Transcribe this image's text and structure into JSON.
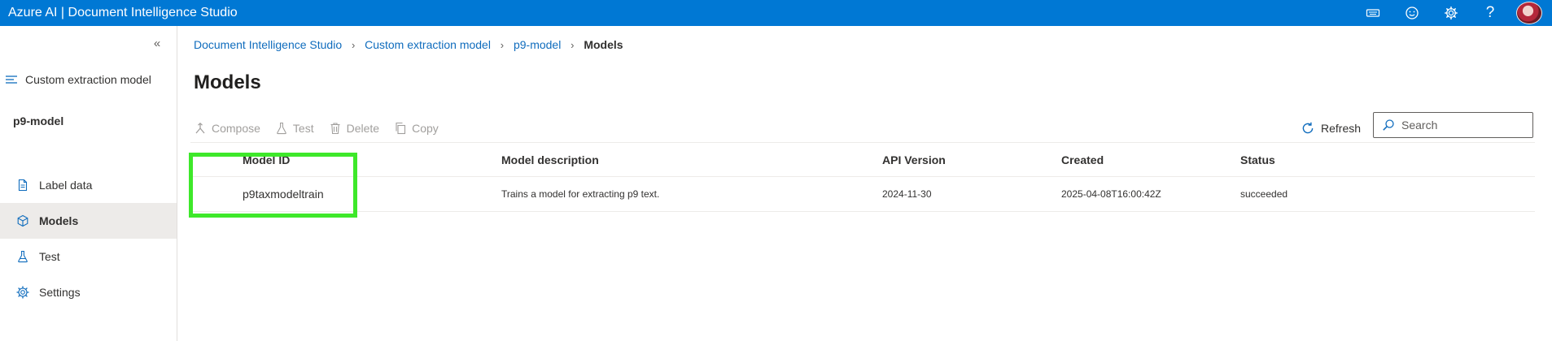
{
  "app": {
    "title": "Azure AI | Document Intelligence Studio"
  },
  "topbar": {
    "icons": [
      "keyboard-icon",
      "feedback-smiley-icon",
      "settings-gear-icon",
      "help-icon"
    ],
    "help_glyph": "?"
  },
  "sidebar": {
    "collapse_glyph": "«",
    "project_label": "Custom extraction model",
    "model_name": "p9-model",
    "items": [
      {
        "label": "Label data",
        "icon": "document-icon",
        "active": false
      },
      {
        "label": "Models",
        "icon": "cube-icon",
        "active": true
      },
      {
        "label": "Test",
        "icon": "flask-icon",
        "active": false
      },
      {
        "label": "Settings",
        "icon": "settings-gear-icon",
        "active": false
      }
    ]
  },
  "breadcrumb": {
    "items": [
      "Document Intelligence Studio",
      "Custom extraction model",
      "p9-model"
    ],
    "current": "Models",
    "separator": "›"
  },
  "page": {
    "title": "Models"
  },
  "commands": {
    "compose": "Compose",
    "test": "Test",
    "delete": "Delete",
    "copy": "Copy",
    "refresh": "Refresh"
  },
  "search": {
    "placeholder": "Search",
    "value": ""
  },
  "table": {
    "columns": [
      "Model ID",
      "Model description",
      "API Version",
      "Created",
      "Status"
    ],
    "rows": [
      {
        "model_id": "p9taxmodeltrain",
        "description": "Trains a model for extracting p9 text.",
        "api_version": "2024-11-30",
        "created": "2025-04-08T16:00:42Z",
        "status": "succeeded"
      }
    ]
  },
  "colors": {
    "accent": "#0078d4",
    "link": "#0f6cbd",
    "highlight": "#3ee82a",
    "active_nav": "#edebe9"
  }
}
